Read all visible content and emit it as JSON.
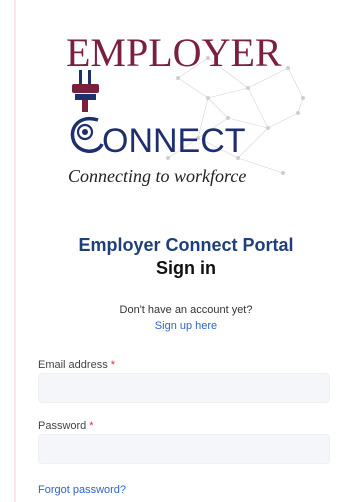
{
  "brand": {
    "logo_top_text": "EMPLOYER",
    "logo_bottom_text": "ONNECT",
    "logo_tagline": "Connecting to workforce"
  },
  "header": {
    "portal_title": "Employer Connect Portal",
    "sign_in_title": "Sign in"
  },
  "signup": {
    "prompt": "Don't have an account yet?",
    "link_label": "Sign up here"
  },
  "form": {
    "email_label": "Email address",
    "email_value": "",
    "password_label": "Password",
    "password_value": "",
    "required_marker": "*",
    "forgot_password_label": "Forgot password?"
  },
  "colors": {
    "brand_maroon": "#7a1f3d",
    "brand_navy": "#1d2f6f",
    "title_blue": "#1f3f7a",
    "link_blue": "#2a67c9",
    "required_red": "#e0303b"
  }
}
